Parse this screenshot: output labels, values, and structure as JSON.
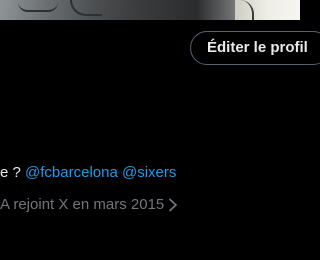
{
  "profile": {
    "edit_button_label": "Éditer le profil",
    "bio": {
      "prefix": "e ?",
      "mentions": [
        "@fcbarcelona",
        "@sixers"
      ]
    },
    "joined_text": "A rejoint X en mars 2015"
  },
  "colors": {
    "background": "#000000",
    "text_primary": "#e7e9ea",
    "text_secondary": "#71767b",
    "link": "#1d9bf0",
    "button_border": "#536471"
  },
  "icons": {
    "joined_chevron": "chevron-right-icon"
  }
}
